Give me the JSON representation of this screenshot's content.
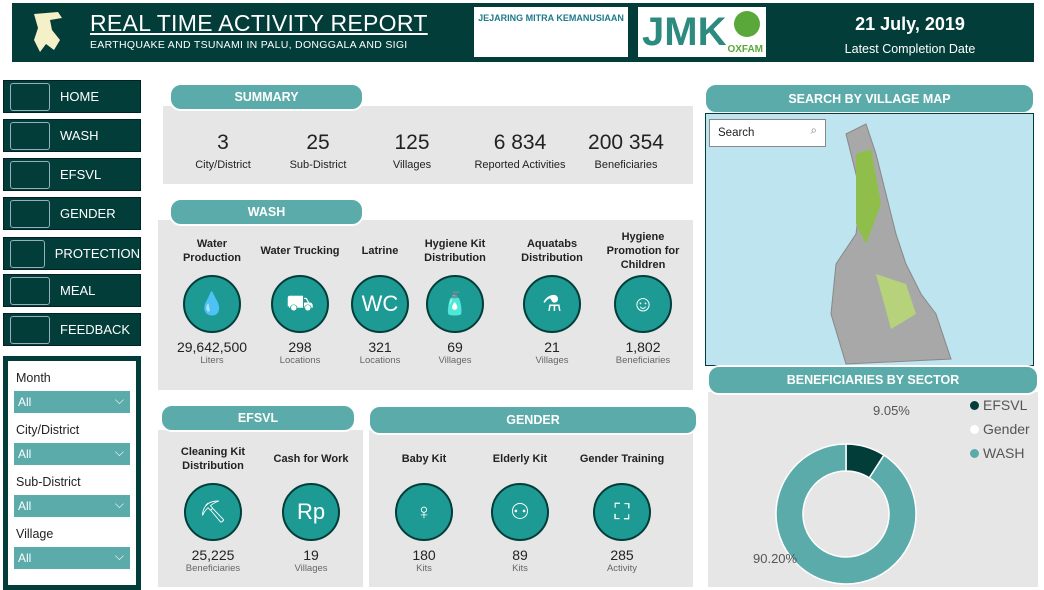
{
  "header": {
    "title": "REAL TIME ACTIVITY REPORT",
    "subtitle": "EARTHQUAKE AND TSUNAMI IN PALU, DONGGALA AND SIGI",
    "partner_logo_text": "JEJARING MITRA KEMANUSIAAN",
    "logo_jmk": "JMK",
    "logo_oxfam": "OXFAM",
    "date": "21 July, 2019",
    "date_label": "Latest Completion Date"
  },
  "nav": [
    {
      "label": "HOME",
      "icon": "home-icon"
    },
    {
      "label": "WASH",
      "icon": "faucet-icon"
    },
    {
      "label": "EFSVL",
      "icon": "wheat-icon"
    },
    {
      "label": "GENDER",
      "icon": "people-icon"
    },
    {
      "label": "PROTECTION",
      "icon": "shield-icon"
    },
    {
      "label": "MEAL",
      "icon": "magnifier-icon"
    },
    {
      "label": "FEEDBACK",
      "icon": "ballot-box-icon"
    }
  ],
  "filters": [
    {
      "label": "Month",
      "value": "All"
    },
    {
      "label": "City/District",
      "value": "All"
    },
    {
      "label": "Sub-District",
      "value": "All"
    },
    {
      "label": "Village",
      "value": "All"
    }
  ],
  "summary": {
    "title": "SUMMARY",
    "stats": [
      {
        "value": "3",
        "label": "City/District"
      },
      {
        "value": "25",
        "label": "Sub-District"
      },
      {
        "value": "125",
        "label": "Villages"
      },
      {
        "value": "6 834",
        "label": "Reported Activities"
      },
      {
        "value": "200 354",
        "label": "Beneficiaries"
      }
    ]
  },
  "wash": {
    "title": "WASH",
    "items": [
      {
        "title": "Water Production",
        "value": "29,642,500",
        "unit": "Liters",
        "icon": "water-drop-icon"
      },
      {
        "title": "Water Trucking",
        "value": "298",
        "unit": "Locations",
        "icon": "water-truck-icon"
      },
      {
        "title": "Latrine",
        "value": "321",
        "unit": "Locations",
        "icon": "wc-icon"
      },
      {
        "title": "Hygiene Kit Distribution",
        "value": "69",
        "unit": "Villages",
        "icon": "hygiene-kit-icon"
      },
      {
        "title": "Aquatabs Distribution",
        "value": "21",
        "unit": "Villages",
        "icon": "aquatabs-icon"
      },
      {
        "title": "Hygiene Promotion for Children",
        "value": "1,802",
        "unit": "Beneficiaries",
        "icon": "children-icon"
      }
    ]
  },
  "efsvl": {
    "title": "EFSVL",
    "items": [
      {
        "title": "Cleaning Kit Distribution",
        "value": "25,225",
        "unit": "Beneficiaries",
        "icon": "wheelbarrow-icon"
      },
      {
        "title": "Cash for Work",
        "value": "19",
        "unit": "Villages",
        "icon": "cash-icon"
      }
    ]
  },
  "gender": {
    "title": "GENDER",
    "items": [
      {
        "title": "Baby Kit",
        "value": "180",
        "unit": "Kits",
        "icon": "baby-icon"
      },
      {
        "title": "Elderly Kit",
        "value": "89",
        "unit": "Kits",
        "icon": "elderly-icon"
      },
      {
        "title": "Gender Training",
        "value": "285",
        "unit": "Activity",
        "icon": "training-icon"
      }
    ]
  },
  "map": {
    "title": "SEARCH BY VILLAGE MAP",
    "search_placeholder": "Search"
  },
  "chart_data": {
    "type": "pie",
    "title": "BENEFICIARIES BY SECTOR",
    "donut": true,
    "legend": [
      "EFSVL",
      "Gender",
      "WASH"
    ],
    "legend_position": "top-right",
    "colors": {
      "EFSVL": "#033d3a",
      "Gender": "#ffffff",
      "WASH": "#5aabaa"
    },
    "slices": [
      {
        "name": "EFSVL",
        "value": 9.05,
        "label": "9.05%"
      },
      {
        "name": "WASH",
        "value": 90.2,
        "label": "90.20%"
      }
    ]
  }
}
